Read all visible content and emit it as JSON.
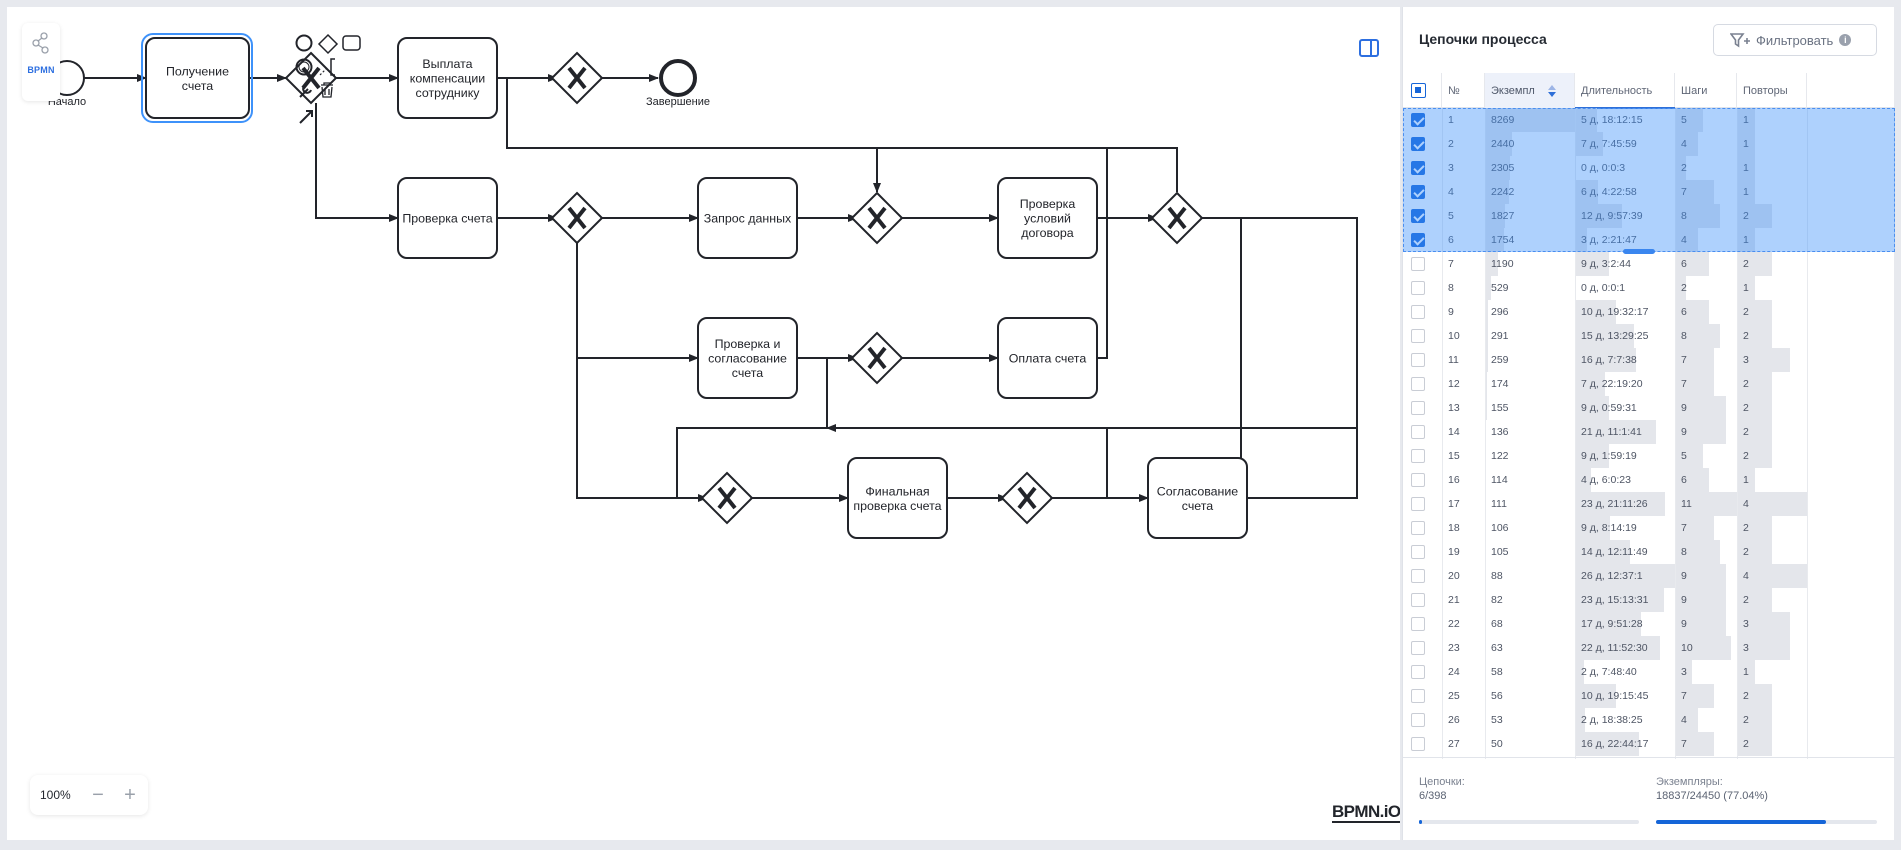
{
  "canvas": {
    "logo_text": "BPMN",
    "zoom": "100%",
    "watermark": "BPMN.iO",
    "nodes": {
      "start": "Начало",
      "end": "Завершение",
      "t_receive": [
        "Получение",
        "счета"
      ],
      "t_payout": [
        "Выплата",
        "компенсации",
        "сотруднику"
      ],
      "t_check_invoice": [
        "Проверка счета"
      ],
      "t_request": [
        "Запрос данных"
      ],
      "t_contract": [
        "Проверка",
        "условий",
        "договора"
      ],
      "t_approve_check": [
        "Проверка и",
        "согласование",
        "счета"
      ],
      "t_pay": [
        "Оплата счета"
      ],
      "t_final": [
        "Финальная",
        "проверка счета"
      ],
      "t_agree": [
        "Согласование",
        "счета"
      ]
    }
  },
  "panel": {
    "title": "Цепочки процесса",
    "filter_label": "Фильтровать",
    "filter_icon": "filter-icon",
    "columns": [
      "№",
      "Экземпл",
      "Длительность",
      "Шаги",
      "Повторы"
    ],
    "rows": [
      {
        "n": "1",
        "inst": "8269",
        "dur": "5 д, 18:12:15",
        "steps": "5",
        "rep": "1",
        "checked": true
      },
      {
        "n": "2",
        "inst": "2440",
        "dur": "7 д, 7:45:59",
        "steps": "4",
        "rep": "1",
        "checked": true
      },
      {
        "n": "3",
        "inst": "2305",
        "dur": "0 д, 0:0:3",
        "steps": "2",
        "rep": "1",
        "checked": true
      },
      {
        "n": "4",
        "inst": "2242",
        "dur": "6 д, 4:22:58",
        "steps": "7",
        "rep": "1",
        "checked": true
      },
      {
        "n": "5",
        "inst": "1827",
        "dur": "12 д, 9:57:39",
        "steps": "8",
        "rep": "2",
        "checked": true
      },
      {
        "n": "6",
        "inst": "1754",
        "dur": "3 д, 2:21:47",
        "steps": "4",
        "rep": "1",
        "checked": true
      },
      {
        "n": "7",
        "inst": "1190",
        "dur": "9 д, 3:2:44",
        "steps": "6",
        "rep": "2",
        "checked": false
      },
      {
        "n": "8",
        "inst": "529",
        "dur": "0 д, 0:0:1",
        "steps": "2",
        "rep": "1",
        "checked": false
      },
      {
        "n": "9",
        "inst": "296",
        "dur": "10 д, 19:32:17",
        "steps": "6",
        "rep": "2",
        "checked": false
      },
      {
        "n": "10",
        "inst": "291",
        "dur": "15 д, 13:29:25",
        "steps": "8",
        "rep": "2",
        "checked": false
      },
      {
        "n": "11",
        "inst": "259",
        "dur": "16 д, 7:7:38",
        "steps": "7",
        "rep": "3",
        "checked": false
      },
      {
        "n": "12",
        "inst": "174",
        "dur": "7 д, 22:19:20",
        "steps": "7",
        "rep": "2",
        "checked": false
      },
      {
        "n": "13",
        "inst": "155",
        "dur": "9 д, 0:59:31",
        "steps": "9",
        "rep": "2",
        "checked": false
      },
      {
        "n": "14",
        "inst": "136",
        "dur": "21 д, 11:1:41",
        "steps": "9",
        "rep": "2",
        "checked": false
      },
      {
        "n": "15",
        "inst": "122",
        "dur": "9 д, 1:59:19",
        "steps": "5",
        "rep": "2",
        "checked": false
      },
      {
        "n": "16",
        "inst": "114",
        "dur": "4 д, 6:0:23",
        "steps": "6",
        "rep": "1",
        "checked": false
      },
      {
        "n": "17",
        "inst": "111",
        "dur": "23 д, 21:11:26",
        "steps": "11",
        "rep": "4",
        "checked": false
      },
      {
        "n": "18",
        "inst": "106",
        "dur": "9 д, 8:14:19",
        "steps": "7",
        "rep": "2",
        "checked": false
      },
      {
        "n": "19",
        "inst": "105",
        "dur": "14 д, 12:11:49",
        "steps": "8",
        "rep": "2",
        "checked": false
      },
      {
        "n": "20",
        "inst": "88",
        "dur": "26 д, 12:37:1",
        "steps": "9",
        "rep": "4",
        "checked": false
      },
      {
        "n": "21",
        "inst": "82",
        "dur": "23 д, 15:13:31",
        "steps": "9",
        "rep": "2",
        "checked": false
      },
      {
        "n": "22",
        "inst": "68",
        "dur": "17 д, 9:51:28",
        "steps": "9",
        "rep": "3",
        "checked": false
      },
      {
        "n": "23",
        "inst": "63",
        "dur": "22 д, 11:52:30",
        "steps": "10",
        "rep": "3",
        "checked": false
      },
      {
        "n": "24",
        "inst": "58",
        "dur": "2 д, 7:48:40",
        "steps": "3",
        "rep": "1",
        "checked": false
      },
      {
        "n": "25",
        "inst": "56",
        "dur": "10 д, 19:15:45",
        "steps": "7",
        "rep": "2",
        "checked": false
      },
      {
        "n": "26",
        "inst": "53",
        "dur": "2 д, 18:38:25",
        "steps": "4",
        "rep": "2",
        "checked": false
      },
      {
        "n": "27",
        "inst": "50",
        "dur": "16 д, 22:44:17",
        "steps": "7",
        "rep": "2",
        "checked": false
      }
    ],
    "footer": {
      "chains_label": "Цепочки:",
      "chains_value": "6/398",
      "chains_fraction": 0.015,
      "instances_label": "Экземпляры:",
      "instances_value": "18837/24450 (77.04%)",
      "instances_fraction": 0.7704
    }
  },
  "colors": {
    "accent": "#1565d8",
    "selection": "#3e92fa",
    "selected_task_border": "#3e92fa"
  }
}
